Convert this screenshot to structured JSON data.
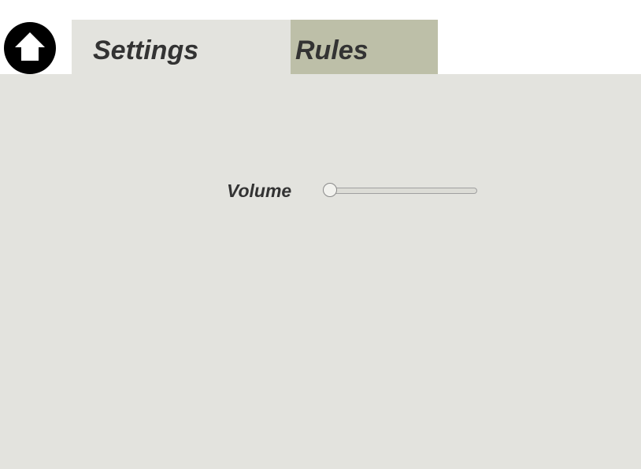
{
  "header": {
    "home_icon": "home-icon",
    "tabs": [
      {
        "label": "Settings",
        "active": true,
        "color": "#e3e3de"
      },
      {
        "label": "Rules",
        "active": false,
        "color": "#bdbfa8"
      }
    ]
  },
  "settings": {
    "volume": {
      "label": "Volume",
      "value": 0
    }
  },
  "colors": {
    "panel_background": "#e3e3de",
    "text": "#333333",
    "home_button": "#000000"
  }
}
